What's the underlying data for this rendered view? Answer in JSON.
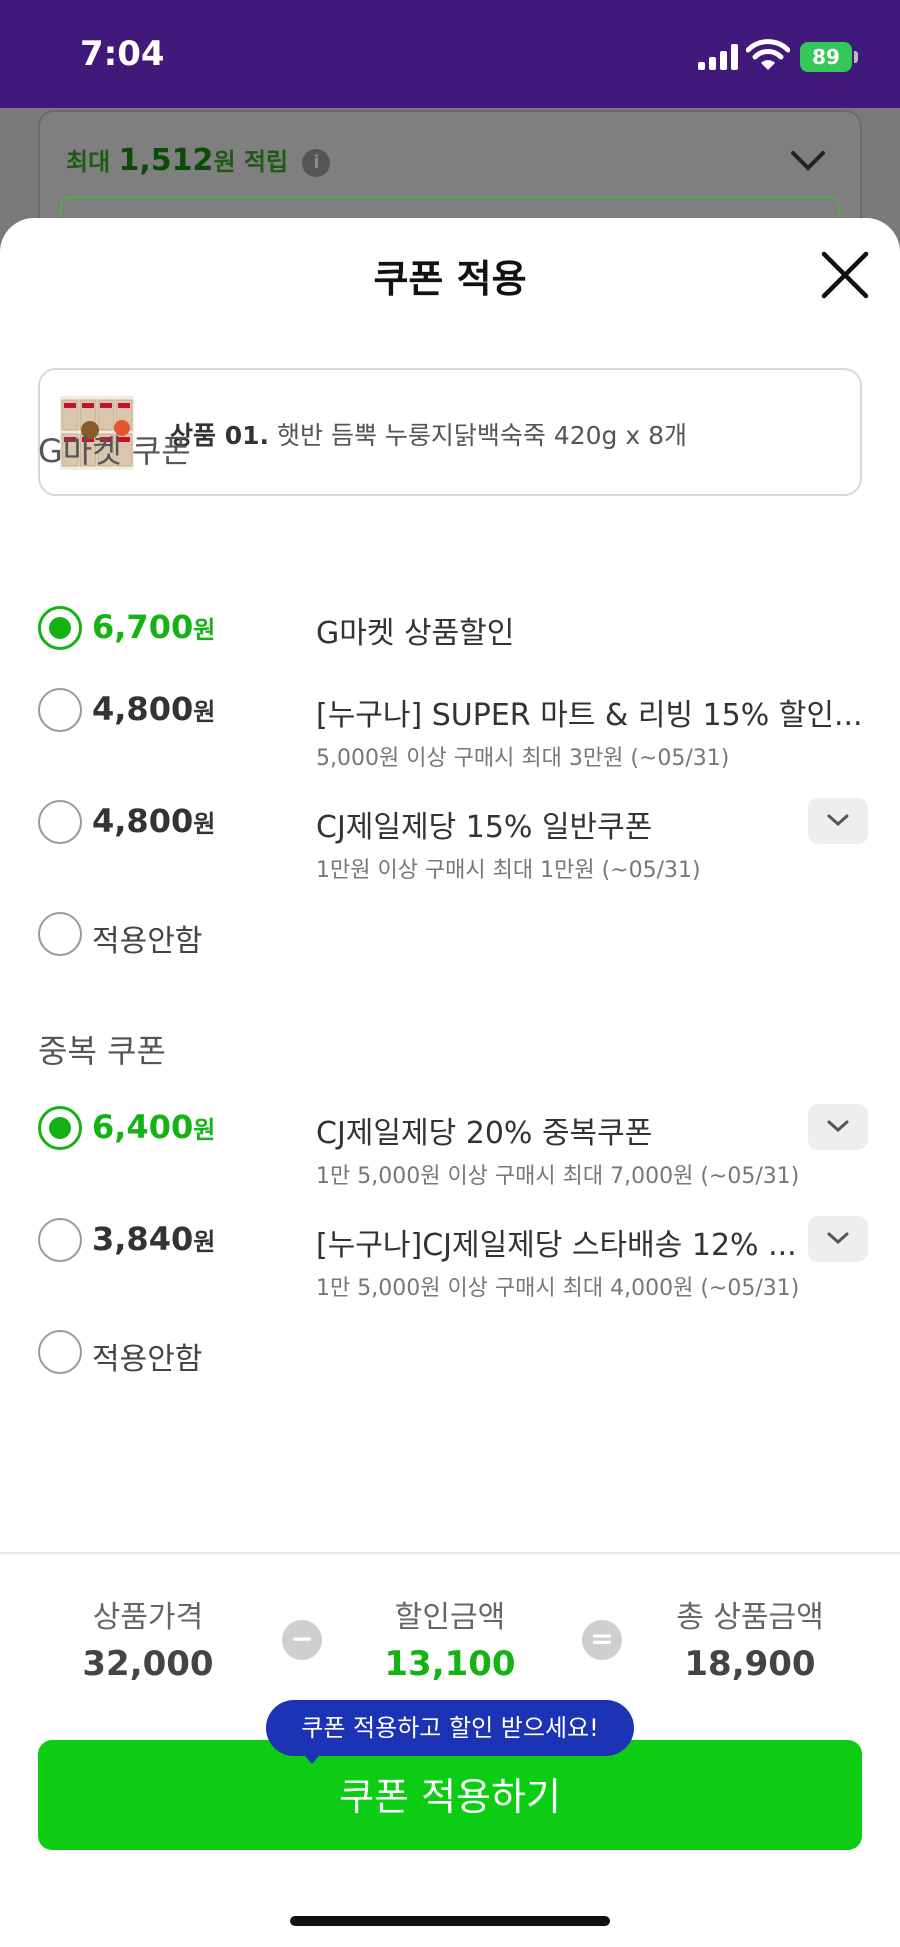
{
  "status_bar": {
    "time": "7:04",
    "battery": "89"
  },
  "background": {
    "points_prefix": "최대",
    "points_value": "1,512",
    "points_suffix": "원 적립",
    "info_icon": "i"
  },
  "sheet": {
    "title": "쿠폰 적용",
    "product": {
      "prefix": "상품 01.",
      "name": "햇반 듬뿍 누룽지닭백숙죽 420g x 8개"
    },
    "gmarket_section": {
      "title": "G마켓 쿠폰",
      "coupons": [
        {
          "amount": "6,700",
          "unit": "원",
          "name": "G마켓 상품할인",
          "desc": "",
          "selected": true
        },
        {
          "amount": "4,800",
          "unit": "원",
          "name": "[누구나] SUPER 마트 & 리빙 15% 할인...",
          "desc": "5,000원 이상 구매시 최대 3만원 (~05/31)",
          "selected": false
        },
        {
          "amount": "4,800",
          "unit": "원",
          "name": "CJ제일제당 15% 일반쿠폰",
          "desc": "1만원 이상 구매시 최대 1만원 (~05/31)",
          "selected": false
        }
      ],
      "no_apply": "적용안함"
    },
    "dup_section": {
      "title": "중복 쿠폰",
      "coupons": [
        {
          "amount": "6,400",
          "unit": "원",
          "name": "CJ제일제당 20% 중복쿠폰",
          "desc": "1만 5,000원 이상 구매시 최대 7,000원 (~05/31)",
          "selected": true
        },
        {
          "amount": "3,840",
          "unit": "원",
          "name": "[누구나]CJ제일제당 스타배송 12% ...",
          "desc": "1만 5,000원 이상 구매시 최대 4,000원 (~05/31)",
          "selected": false
        }
      ],
      "no_apply": "적용안함"
    },
    "summary": {
      "price_label": "상품가격",
      "price_value": "32,000",
      "minus": "−",
      "discount_label": "할인금액",
      "discount_value": "13,100",
      "equals": "=",
      "total_label": "총 상품금액",
      "total_value": "18,900"
    },
    "tooltip": "쿠폰 적용하고 할인 받으세요!",
    "apply_button": "쿠폰 적용하기"
  },
  "colors": {
    "accent_green": "#14b214",
    "button_green": "#0ccd13",
    "status_purple": "#40197a",
    "tooltip_blue": "#1c33b5"
  }
}
